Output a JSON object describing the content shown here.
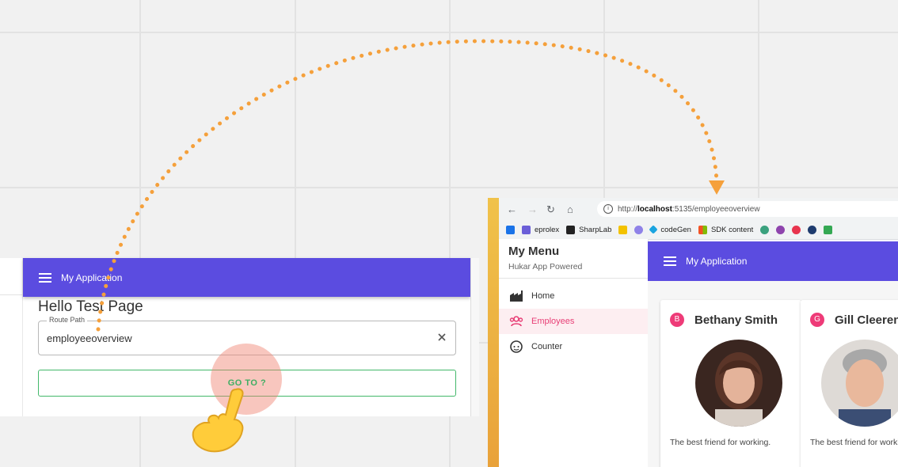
{
  "left_app": {
    "appbar_title": "My Application",
    "page_heading": "Hello Test Page",
    "route_field": {
      "label": "Route Path",
      "value": "employeeoverview"
    },
    "goto_button_label": "GO TO ?"
  },
  "browser": {
    "url_prefix": "http://",
    "url_host": "localhost",
    "url_rest": ":5135/employeeoverview",
    "bookmarks": [
      {
        "label": "eprolex",
        "color": "#6b5fd8"
      },
      {
        "label": "SharpLab",
        "color": "#222222"
      },
      {
        "label": "codeGen",
        "color": "#1aa4e0"
      },
      {
        "label": "SDK content",
        "color": "#f35325"
      }
    ],
    "drawer": {
      "title": "My Menu",
      "subtitle": "Hukar App Powered",
      "items": [
        {
          "label": "Home",
          "icon": "factory-icon",
          "active": false
        },
        {
          "label": "Employees",
          "icon": "group-icon",
          "active": true
        },
        {
          "label": "Counter",
          "icon": "face-icon",
          "active": false
        }
      ]
    },
    "appbar_title": "My Application",
    "employees": [
      {
        "initial": "B",
        "name": "Bethany Smith",
        "description": "The best friend for working."
      },
      {
        "initial": "G",
        "name": "Gill Cleeren",
        "description": "The best friend for working."
      }
    ]
  },
  "colors": {
    "appbar": "#5b4ce0",
    "goto_accent": "#3fae63",
    "arrow": "#f5a03b",
    "active_nav": "#e83f76",
    "avatar": "#ee3b78"
  }
}
